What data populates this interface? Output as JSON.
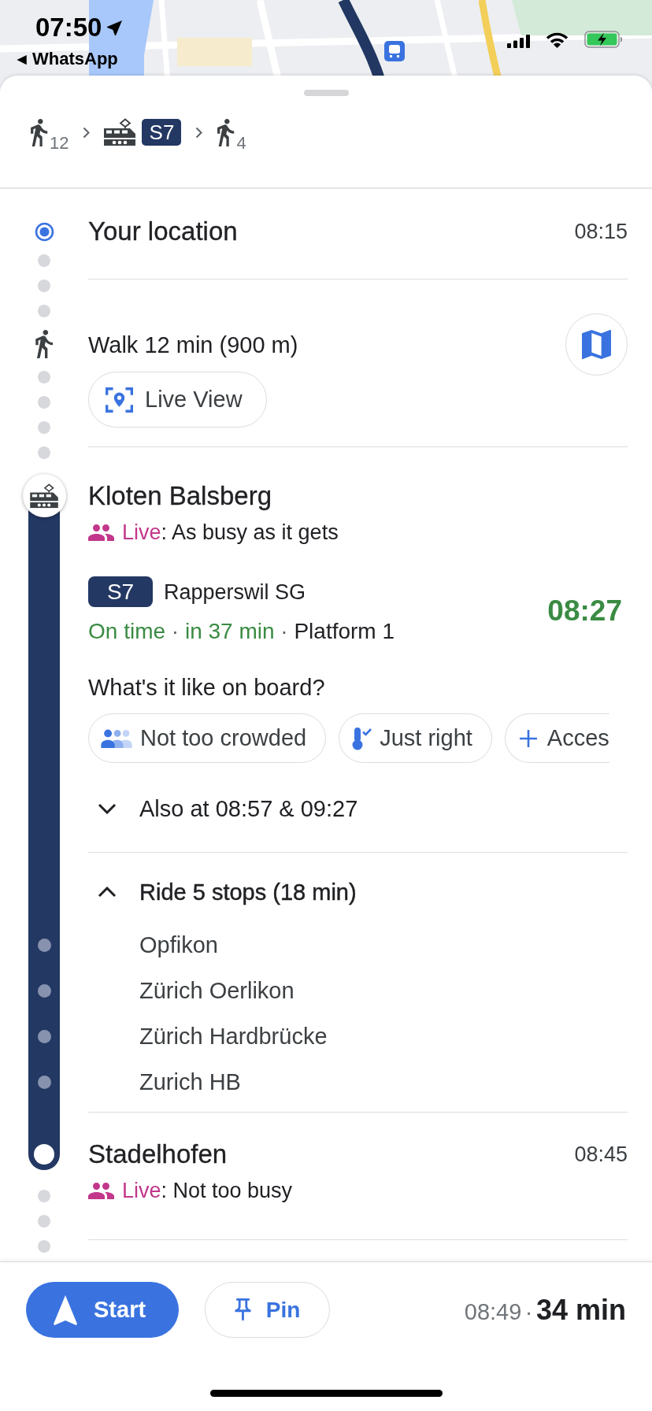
{
  "status_bar": {
    "time": "07:50",
    "back_arrow": "◀",
    "back_label": "WhatsApp"
  },
  "route_summary": [
    {
      "kind": "walk",
      "minutes": "12"
    },
    {
      "kind": "train",
      "line": "S7"
    },
    {
      "kind": "walk",
      "minutes": "4"
    }
  ],
  "origin": {
    "name": "Your location",
    "time": "08:15"
  },
  "walk": {
    "text": "Walk 12 min (900 m)",
    "live_view": "Live View"
  },
  "boarding": {
    "name": "Kloten Balsberg",
    "crowd_label": "Live",
    "crowd_text": ": As busy as it gets",
    "line": "S7",
    "destination": "Rapperswil SG",
    "departure_time": "08:27",
    "status": [
      {
        "text": "On time",
        "kind": "realtime"
      },
      {
        "text": "·",
        "kind": "separator"
      },
      {
        "text": "in 37 min",
        "kind": "realtime"
      },
      {
        "text": "·",
        "kind": "separator"
      },
      {
        "text": "Platform 1",
        "kind": "plain"
      }
    ],
    "question": "What's it like on board?",
    "chips": [
      {
        "kind": "crowding",
        "label": "Not too crowded",
        "truncated": false
      },
      {
        "kind": "temperature",
        "label": "Just right",
        "truncated": false
      },
      {
        "kind": "add",
        "label": "Acces",
        "truncated": true
      }
    ],
    "also_at": {
      "text": "Also at 08:57 & 09:27",
      "expanded": false
    }
  },
  "ride": {
    "text": "Ride 5 stops (18 min)",
    "expanded": true,
    "stops": [
      "Opfikon",
      "Zürich Oerlikon",
      "Zürich Hardbrücke",
      "Zurich HB"
    ]
  },
  "arrival_stop": {
    "name": "Stadelhofen",
    "time": "08:45",
    "crowd_label": "Live",
    "crowd_text": ": Not too busy"
  },
  "bottom_bar": {
    "start": "Start",
    "pin": "Pin",
    "arrival_time": "08:49",
    "separator": "·",
    "duration": "34 min"
  }
}
